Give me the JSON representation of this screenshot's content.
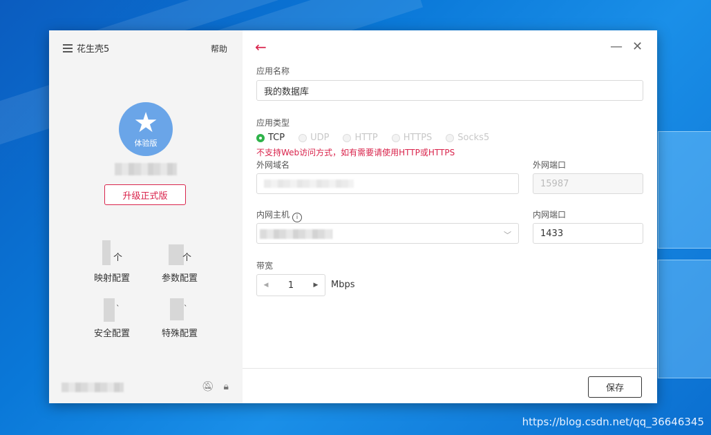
{
  "sidebar": {
    "app_title": "花生壳5",
    "help_label": "帮助",
    "avatar_badge": "体验版",
    "upgrade_label": "升级正式版",
    "features": [
      {
        "label": "映射配置",
        "icon": "mapping-icon"
      },
      {
        "label": "参数配置",
        "icon": "parameter-icon"
      },
      {
        "label": "安全配置",
        "icon": "security-icon"
      },
      {
        "label": "特殊配置",
        "icon": "special-icon"
      }
    ],
    "footer_icons": [
      "notification-icon",
      "lock-icon"
    ]
  },
  "form": {
    "app_name_label": "应用名称",
    "app_name_value": "我的数据库",
    "app_type_label": "应用类型",
    "app_types": [
      {
        "label": "TCP",
        "checked": true,
        "disabled": false
      },
      {
        "label": "UDP",
        "checked": false,
        "disabled": true
      },
      {
        "label": "HTTP",
        "checked": false,
        "disabled": true
      },
      {
        "label": "HTTPS",
        "checked": false,
        "disabled": true
      },
      {
        "label": "Socks5",
        "checked": false,
        "disabled": true
      }
    ],
    "warning": "不支持Web访问方式，如有需要请使用HTTP或HTTPS",
    "external_domain_label": "外网域名",
    "external_port_label": "外网端口",
    "external_port_value": "15987",
    "internal_host_label": "内网主机",
    "internal_port_label": "内网端口",
    "internal_port_value": "1433",
    "bandwidth_label": "带宽",
    "bandwidth_value": "1",
    "bandwidth_unit": "Mbps",
    "save_label": "保存"
  },
  "window": {
    "minimize_glyph": "—",
    "close_glyph": "✕",
    "back_glyph": "←"
  },
  "desktop": {
    "watermark": "https://blog.csdn.net/qq_36646345"
  },
  "colors": {
    "accent": "#d9234b",
    "radio_checked": "#2fb34a",
    "avatar": "#6aa5e8"
  }
}
